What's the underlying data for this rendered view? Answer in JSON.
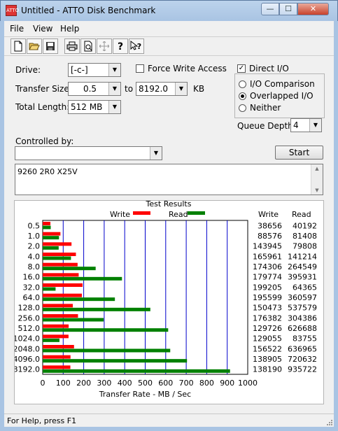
{
  "window": {
    "title": "Untitled - ATTO Disk Benchmark",
    "app_icon_text": "ATTO",
    "min": "—",
    "max": "☐",
    "close": "✕"
  },
  "menu": [
    "File",
    "View",
    "Help"
  ],
  "toolbar": {
    "icons": [
      "new-icon",
      "open-icon",
      "save-icon",
      "print-icon",
      "print-preview-icon",
      "move-icon",
      "help-icon",
      "context-help-icon"
    ]
  },
  "form": {
    "drive_label": "Drive:",
    "drive_value": "[-c-]",
    "force_write_label": "Force Write Access",
    "force_write_checked": false,
    "direct_io_label": "Direct I/O",
    "direct_io_checked": true,
    "transfer_size_label": "Transfer Size:",
    "transfer_from": "0.5",
    "to_label": "to",
    "transfer_to": "8192.0",
    "kb_label": "KB",
    "total_length_label": "Total Length:",
    "total_length_value": "512 MB",
    "io_options": [
      {
        "label": "I/O Comparison",
        "selected": false
      },
      {
        "label": "Overlapped I/O",
        "selected": true
      },
      {
        "label": "Neither",
        "selected": false
      }
    ],
    "queue_depth_label": "Queue Depth:",
    "queue_depth_value": "4",
    "controlled_by_label": "Controlled by:",
    "controlled_by_value": "",
    "start_label": "Start",
    "description": "9260 2R0 X25V"
  },
  "chart_data": {
    "type": "bar",
    "title": "Test Results",
    "legend": [
      {
        "name": "Write",
        "color": "#ff0000"
      },
      {
        "name": "Read",
        "color": "#008000"
      }
    ],
    "categories": [
      "0.5",
      "1.0",
      "2.0",
      "4.0",
      "8.0",
      "16.0",
      "32.0",
      "64.0",
      "128.0",
      "256.0",
      "512.0",
      "1024.0",
      "2048.0",
      "4096.0",
      "8192.0"
    ],
    "series": [
      {
        "name": "Write",
        "values": [
          38656,
          88576,
          143945,
          165961,
          174306,
          179774,
          199205,
          195599,
          150473,
          176382,
          129726,
          129055,
          156522,
          138905,
          138190
        ]
      },
      {
        "name": "Read",
        "values": [
          40192,
          81408,
          79808,
          141214,
          264549,
          395931,
          64365,
          360597,
          537579,
          304386,
          626688,
          83755,
          636965,
          720632,
          935722
        ]
      }
    ],
    "xlabel": "Transfer Rate - MB / Sec",
    "xticks": [
      "0",
      "100",
      "200",
      "300",
      "400",
      "500",
      "600",
      "700",
      "800",
      "900",
      "1000"
    ],
    "xlim": [
      0,
      1000
    ],
    "write_header": "Write",
    "read_header": "Read"
  },
  "status": "For Help, press F1"
}
